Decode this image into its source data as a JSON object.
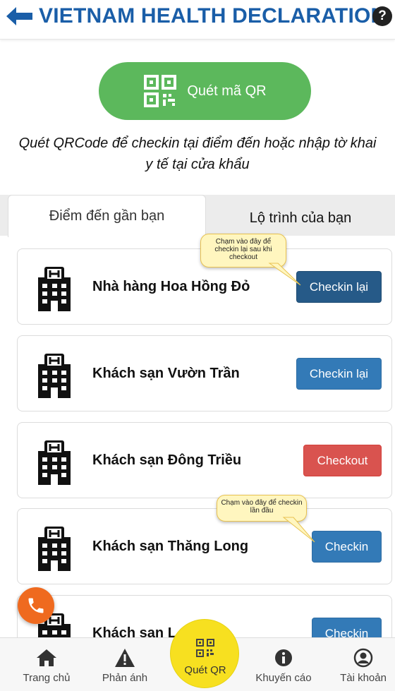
{
  "header": {
    "title": "VIETNAM HEALTH DECLARATION",
    "back_icon": "arrow-left-icon",
    "help_icon": "question-circle-icon",
    "help_symbol": "?"
  },
  "qr_button": {
    "label": "Quét mã QR",
    "icon": "qrcode-icon",
    "color": "#5cb85c"
  },
  "intro_text": "Quét QRCode để checkin tại điểm đến hoặc nhập tờ khai y tế tại cửa khẩu",
  "tabs": [
    {
      "label": "Điểm đến gần bạn",
      "active": true
    },
    {
      "label": "Lộ trình của bạn",
      "active": false
    }
  ],
  "places": [
    {
      "name": "Nhà hàng Hoa Hồng Đỏ",
      "button": "Checkin lại",
      "button_color": "#265a88"
    },
    {
      "name": "Khách sạn Vườn Trần",
      "button": "Checkin lại",
      "button_color": "#337ab7"
    },
    {
      "name": "Khách sạn Đông Triều",
      "button": "Checkout",
      "button_color": "#d9534f"
    },
    {
      "name": "Khách sạn Thăng Long",
      "button": "Checkin",
      "button_color": "#337ab7"
    },
    {
      "name": "Khách sạn L",
      "button": "Checkin",
      "button_color": "#337ab7"
    }
  ],
  "tooltips": {
    "recheckin": "Chạm vào đây để checkin lại sau khi checkout",
    "first_checkin": "Chạm vào đây để checkin lần đầu"
  },
  "fab": {
    "icon": "phone-icon",
    "color": "#ef6a1f"
  },
  "bottom_nav": [
    {
      "label": "Trang chủ",
      "icon": "home-icon"
    },
    {
      "label": "Phản ánh",
      "icon": "warning-icon"
    },
    {
      "label": "Quét QR",
      "icon": "qrcode-icon",
      "color": "#f7e020"
    },
    {
      "label": "Khuyến cáo",
      "icon": "info-circle-icon"
    },
    {
      "label": "Tài khoản",
      "icon": "user-circle-icon"
    }
  ]
}
